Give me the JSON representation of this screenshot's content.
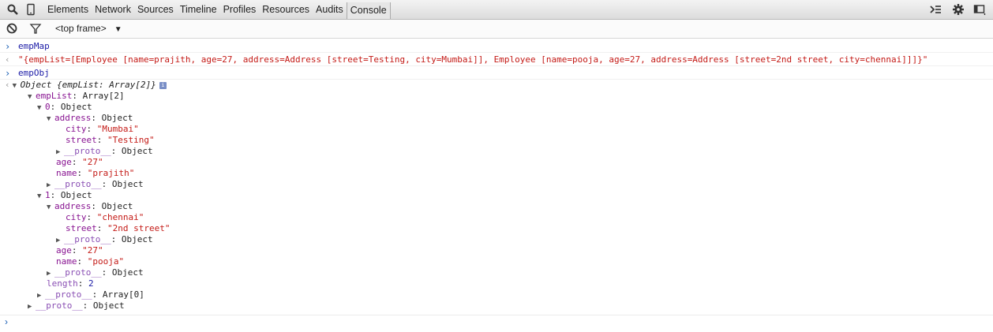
{
  "toolbar": {
    "tabs": [
      "Elements",
      "Network",
      "Sources",
      "Timeline",
      "Profiles",
      "Resources",
      "Audits",
      "Console"
    ],
    "icons": [
      "search-icon",
      "device-icon",
      "execute-icon",
      "settings-icon",
      "dock-icon"
    ]
  },
  "filterbar": {
    "frame": "<top frame>",
    "frame_caret": "▼"
  },
  "console": {
    "cmd1": "empMap",
    "result1": "\"{empList=[Employee [name=prajith, age=27, address=Address [street=Testing, city=Mumbai]], Employee [name=pooja, age=27, address=Address [street=2nd street, city=chennai]]]}\"",
    "cmd2": "empObj",
    "tree": {
      "root": "Object {empList: Array[2]}",
      "empList_key": "empList",
      "empList_val": "Array[2]",
      "item0_key": "0",
      "item0_val": "Object",
      "address_key": "address",
      "address_val": "Object",
      "city0": "\"Mumbai\"",
      "street0": "\"Testing\"",
      "proto_key": "__proto__",
      "proto_val": "Object",
      "age0": "\"27\"",
      "name0": "\"prajith\"",
      "item1_key": "1",
      "item1_val": "Object",
      "city1": "\"chennai\"",
      "street1": "\"2nd street\"",
      "age1": "\"27\"",
      "name1": "\"pooja\"",
      "length_key": "length",
      "length_val": "2",
      "array_proto_val": "Array[0]",
      "city_key": "city",
      "street_key": "street",
      "age_key": "age",
      "name_key": "name"
    }
  }
}
